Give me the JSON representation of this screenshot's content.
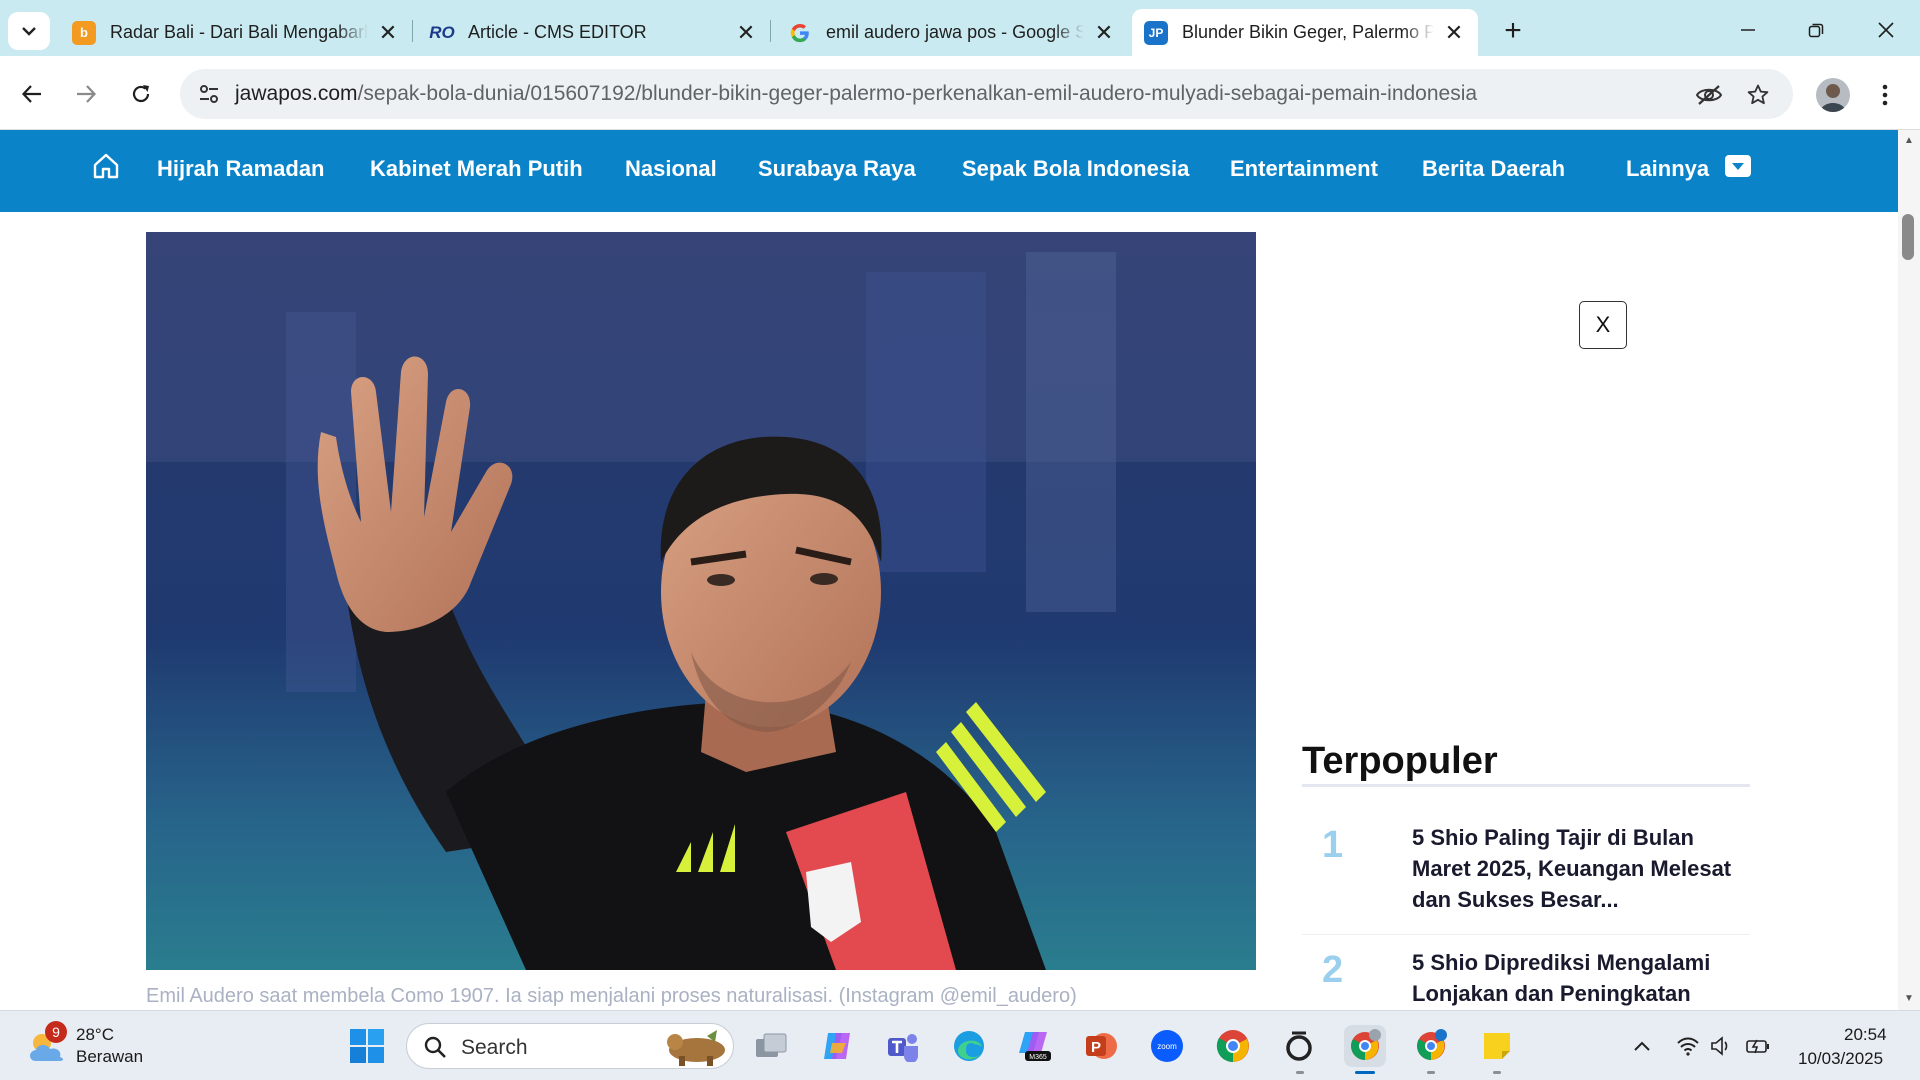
{
  "browser": {
    "tabs": [
      {
        "title": "Radar Bali - Dari Bali Mengabarkan",
        "favicon": "radarbali-favicon",
        "favicon_color": "#f29a21"
      },
      {
        "title": "Article - CMS EDITOR",
        "favicon": "cms-favicon",
        "favicon_color": "#1b3a8a"
      },
      {
        "title": "emil audero jawa pos - Google Search",
        "favicon": "google-favicon",
        "favicon_color": "#4285f4"
      },
      {
        "title": "Blunder Bikin Geger, Palermo Perkenalkan",
        "favicon": "jawapos-favicon",
        "favicon_color": "#1a73c8"
      }
    ],
    "active_tab": 3,
    "url_host": "jawapos.com",
    "url_path": "/sepak-bola-dunia/015607192/blunder-bikin-geger-palermo-perkenalkan-emil-audero-mulyadi-sebagai-pemain-indonesia"
  },
  "site_nav": {
    "items": [
      "Hijrah Ramadan",
      "Kabinet Merah Putih",
      "Nasional",
      "Surabaya Raya",
      "Sepak Bola Indonesia",
      "Entertainment",
      "Berita Daerah",
      "Lainnya"
    ],
    "bg_color": "#0b83c9"
  },
  "article": {
    "image_caption": "Emil Audero saat membela Como 1907. Ia siap menjalani proses naturalisasi. (Instagram @emil_audero)"
  },
  "ad": {
    "close_label": "X"
  },
  "popular": {
    "heading": "Terpopuler",
    "items": [
      {
        "rank": "1",
        "title": "5 Shio Paling Tajir di Bulan Maret 2025, Keuangan Melesat dan Sukses Besar..."
      },
      {
        "rank": "2",
        "title": "5 Shio Diprediksi Mengalami Lonjakan dan Peningkatan"
      }
    ]
  },
  "taskbar": {
    "weather_badge": "9",
    "temperature": "28°C",
    "weather_desc": "Berawan",
    "search_placeholder": "Search",
    "time": "20:54",
    "date": "10/03/2025"
  }
}
